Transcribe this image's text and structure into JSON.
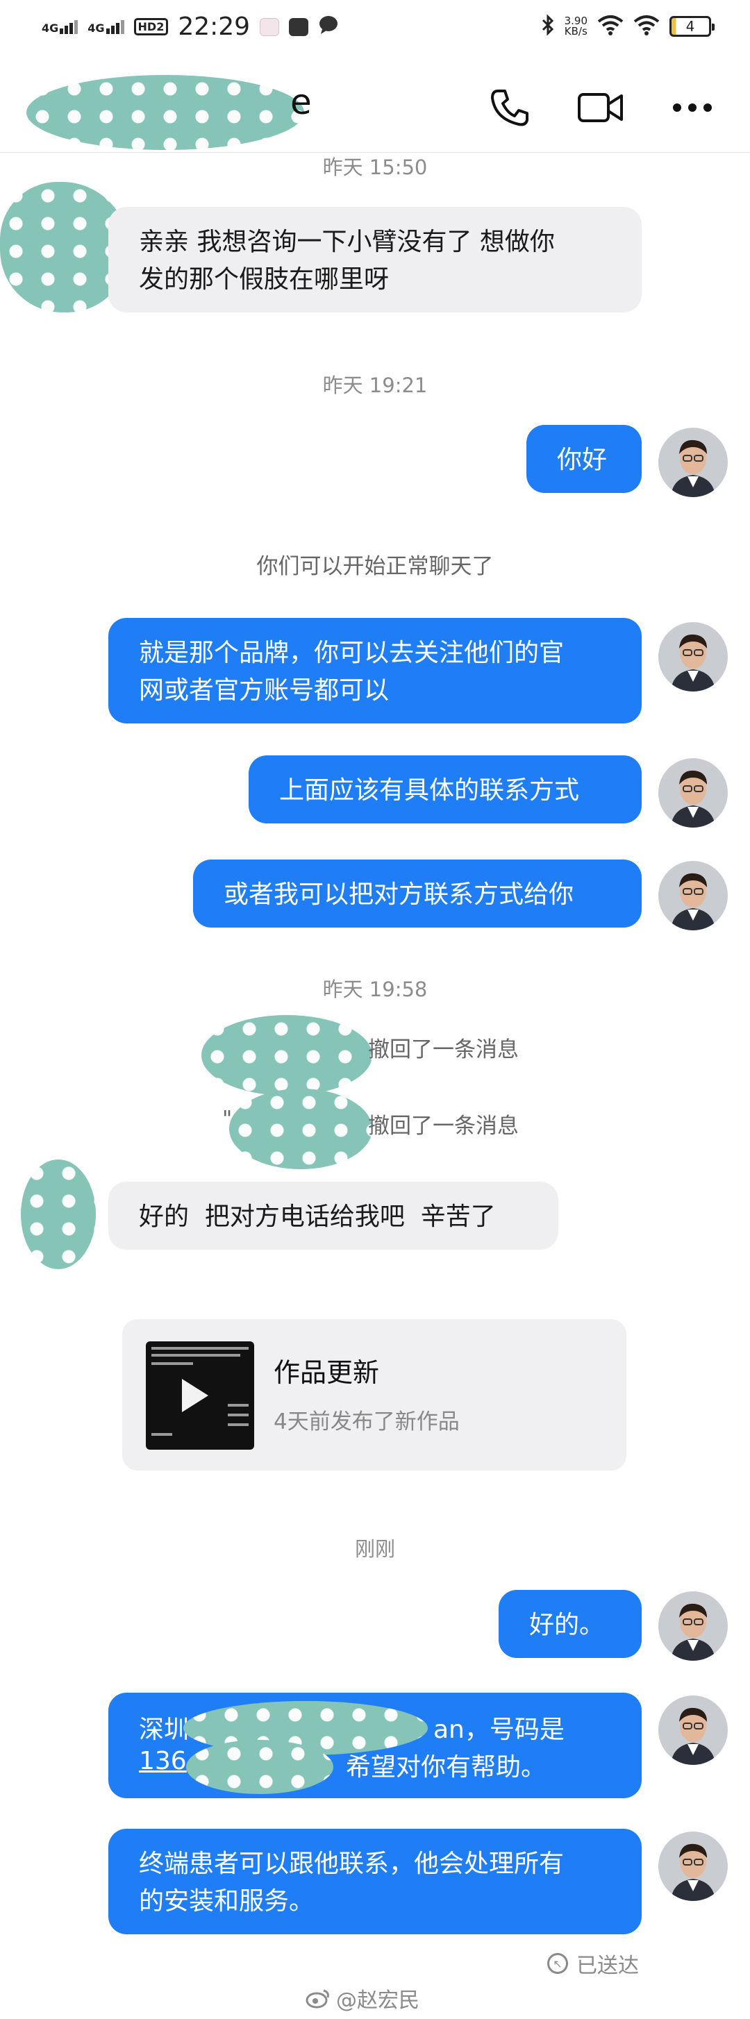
{
  "status_bar": {
    "signal1": "4G",
    "signal2": "4G",
    "hd": "HD2",
    "time": "22:29",
    "speed_value": "3.90",
    "speed_unit": "KB/s",
    "battery": "4"
  },
  "header": {
    "contact_name_visible": "e"
  },
  "messages": {
    "time1": "昨天 15:50",
    "in1_line1": "亲亲  我想咨询一下小臂没有了 想做你",
    "in1_line2": "发的那个假肢在哪里呀",
    "time2": "昨天 19:21",
    "out1": "你好",
    "sys1": "你们可以开始正常聊天了",
    "out2_line1": "就是那个品牌，你可以去关注他们的官",
    "out2_line2": "网或者官方账号都可以",
    "out3": "上面应该有具体的联系方式",
    "out4": "或者我可以把对方联系方式给你",
    "time3": "昨天 19:58",
    "recall1": "撤回了一条消息",
    "recall2_prefix": "\"",
    "recall2": "撤回了一条消息",
    "in2": "好的  把对方电话给我吧  辛苦了",
    "card_title": "作品更新",
    "card_sub": "4天前发布了新作品",
    "time4": "刚刚",
    "out5": "好的。",
    "out6_line1_a": "深圳",
    "out6_line1_b": "an，号码是",
    "out6_line2_a": "136",
    "out6_line2_b": "希望对你有帮助。",
    "out7_line1": "终端患者可以跟他联系，他会处理所有",
    "out7_line2": "的安装和服务。",
    "sent_status": "已送达",
    "watermark": "@赵宏民"
  },
  "colors": {
    "bubble_out": "#1f7ef5",
    "bubble_in": "#efeff1",
    "mask": "#86c4b8"
  }
}
